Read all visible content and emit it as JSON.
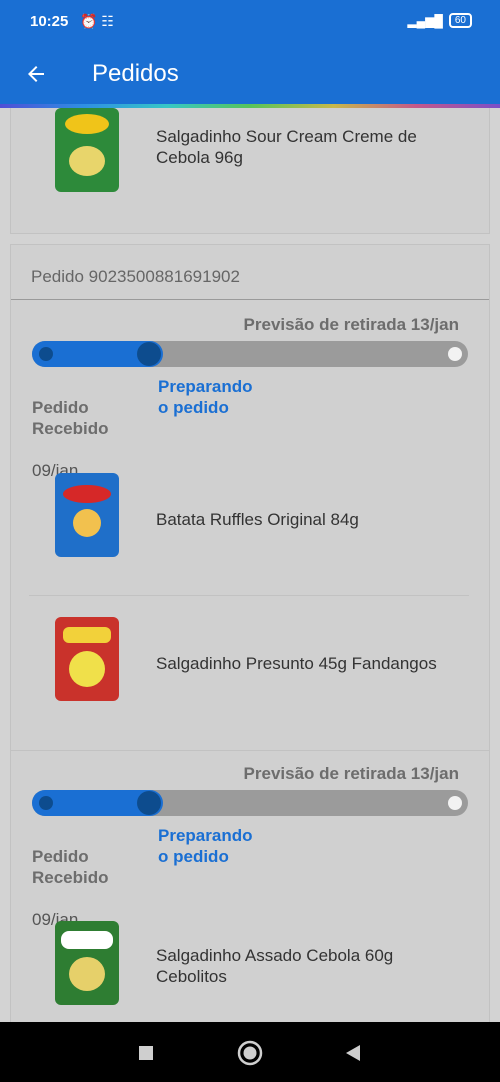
{
  "status_bar": {
    "time": "10:25",
    "left_icons": "⏰ ☷",
    "signal": "▂▄▆█",
    "battery": "60"
  },
  "app_bar": {
    "title": "Pedidos"
  },
  "top_card": {
    "item": {
      "name": "Salgadinho Sour Cream Creme de Cebola 96g",
      "thumb_color": "#2d8a3a"
    }
  },
  "order": {
    "id_text": "Pedido 9023500881691902",
    "shipments": [
      {
        "forecast": "Previsão de retirada 13/jan",
        "progress": 0.3,
        "step_received": "Pedido\nRecebido",
        "step_received_date": "09/jan",
        "step_current": "Preparando\no pedido",
        "items": [
          {
            "name": "Batata Ruffles Original 84g",
            "thumb_color": "#1f6fc9"
          },
          {
            "name": "Salgadinho Presunto 45g Fandangos",
            "thumb_color": "#c9322b"
          }
        ]
      },
      {
        "forecast": "Previsão de retirada 13/jan",
        "progress": 0.3,
        "step_received": "Pedido\nRecebido",
        "step_received_date": "09/jan",
        "step_current": "Preparando\no pedido",
        "items": [
          {
            "name": "Salgadinho Assado Cebola 60g Cebolitos",
            "thumb_color": "#2e7d32"
          }
        ]
      }
    ]
  },
  "colors": {
    "primary": "#1a6fd3",
    "progress_knob": "#0d4c8e"
  }
}
